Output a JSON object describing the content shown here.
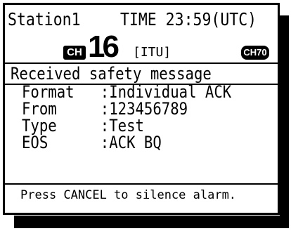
{
  "header": {
    "station": "Station1",
    "time": "TIME 23:59(UTC)"
  },
  "channel": {
    "badge": "CH",
    "number": "16",
    "band": "[ITU]",
    "secondary_badge": "CH70"
  },
  "message": {
    "heading": "Received safety message",
    "fields": [
      {
        "label": "Format",
        "value": ":Individual ACK"
      },
      {
        "label": "From",
        "value": ":123456789"
      },
      {
        "label": "Type",
        "value": ":Test"
      },
      {
        "label": "EOS",
        "value": ":ACK BQ"
      }
    ]
  },
  "status": {
    "text": "Press CANCEL to silence alarm."
  },
  "colors": {
    "foreground": "#000000",
    "background": "#ffffff"
  }
}
